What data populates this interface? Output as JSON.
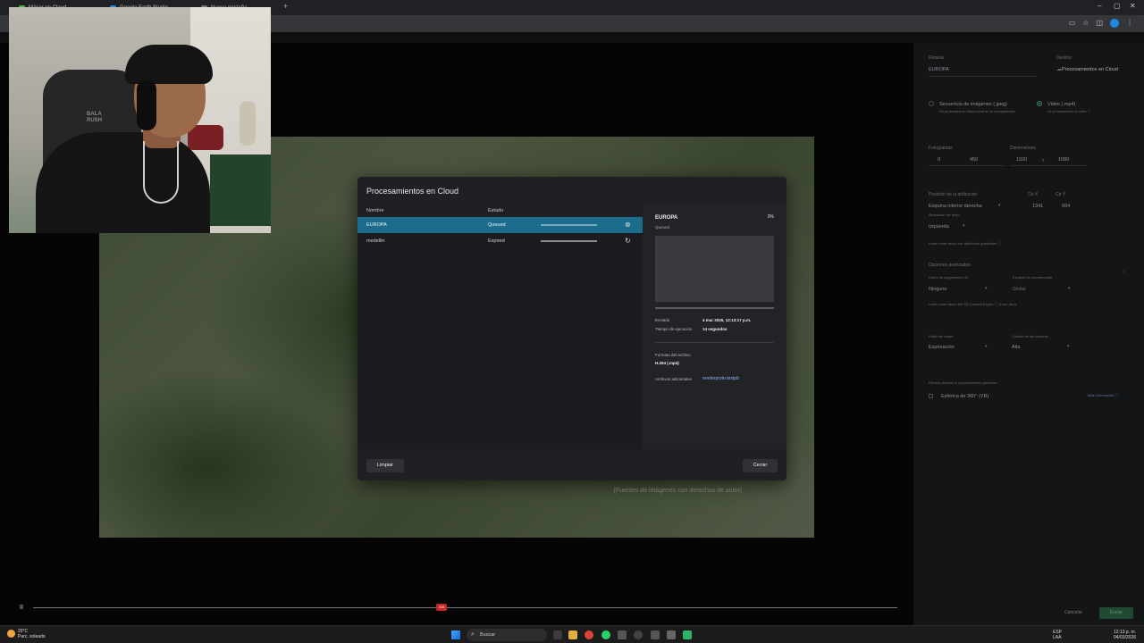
{
  "browser": {
    "tabs": [
      {
        "label": "Mäser en Cloud..."
      },
      {
        "label": "Google Earth Studio"
      },
      {
        "label": "Nueva pestaña"
      }
    ],
    "new_tab": "+",
    "window_controls": [
      "–",
      "▢",
      "✕"
    ]
  },
  "map": {
    "credit": "[Fuentes de imágenes con derechos de autor]"
  },
  "dialog": {
    "title": "Procesamientos en Cloud",
    "col_name": "Nombre",
    "col_state": "Estado",
    "rows": [
      {
        "name": "EUROPA",
        "state": "Queued",
        "action": "⊗",
        "selected": true
      },
      {
        "name": "medellin",
        "state": "Expired",
        "action": "↻",
        "selected": false
      }
    ],
    "detail": {
      "title": "EUROPA",
      "percent": "0%",
      "status": "Queued",
      "sent_label": "Enviado",
      "sent_value": "4 mar 2026, 12:13:17 p.m.",
      "exec_label": "Tiempo de ejecución",
      "exec_value": "14 segundos",
      "format_label": "Formato del archivo",
      "format_value": "H.264 (.mp4)",
      "extra_label": "Archivos adicionales",
      "extra_link": "renderproto.textpb"
    },
    "clear_button": "Limpiar",
    "close_button": "Cerrar"
  },
  "panel": {
    "route_label": "Ruta/as",
    "route_value": "EUROPA",
    "dest_label": "Destino",
    "dest_value": "Procesamientos en Cloud",
    "opt_seq": "Secuencia de imágenes (.jpeg)",
    "opt_seq_sub": "Se procesará en forma local en tu computadora",
    "opt_video": "Video (.mp4)",
    "opt_video_sub": "Se procesará en la nube ⓘ",
    "frames_label": "Fotogramas",
    "frames_from": "0",
    "frames_to": "450",
    "dims_label": "Dimensiones",
    "dim_w": "1920",
    "dim_x": "x",
    "dim_h": "1080",
    "attr_pos_label": "Posición de la atribución",
    "attr_pos_value": "Esquina inferior derecha",
    "pos_x_label": "Ctr X",
    "pos_y_label": "Ctr Y",
    "pos_x": "1341",
    "pos_y": "664",
    "align_label": "Alineación del texto",
    "align_value": "Izquierda",
    "attr_note": "Learn more about our attribution guidelines ⓘ",
    "adv_label": "Opciones avanzadas",
    "track_label": "Datos de seguimiento 3D",
    "track_value": "Ninguno",
    "coord_label": "Espacio de coordenadas",
    "coord_value": "Global",
    "cam_note": "Learn more about the 3D Camera Export ⓘ in our docs.",
    "map_style_label": "Estilo del mapa",
    "map_style_value": "Exploración",
    "texture_label": "Calidad de las texturas",
    "texture_value": "Alta",
    "post_label": "Efectos durante el procesamiento posterior",
    "more_info": "Más información ⓘ",
    "vr_label": "Esférica de 360° (VR)",
    "cancel": "Cancelar",
    "submit": "Enviar"
  },
  "player": {
    "play_icon": "II",
    "marker": "316"
  },
  "taskbar": {
    "temp": "20°C",
    "weather": "Parc. soleado",
    "search": "Buscar",
    "lang": "ESP",
    "lang2": "LAA",
    "time": "12:13 p. m.",
    "date": "04/03/2026"
  },
  "colors": {
    "accent_selected_row": "#1c6d8c",
    "submit_green": "#3c8d5f",
    "marker_red": "#c62828"
  }
}
